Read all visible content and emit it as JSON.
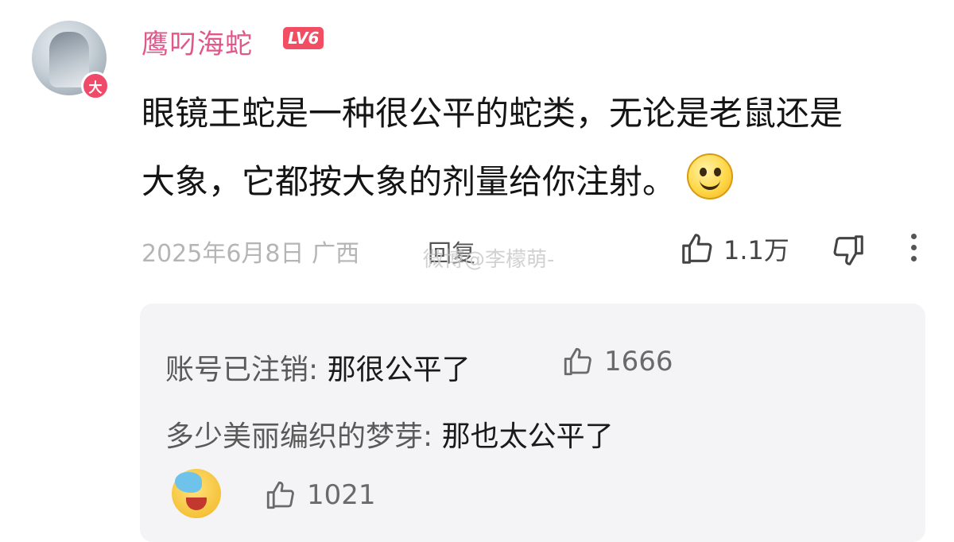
{
  "user": {
    "name": "鹰叼海蛇",
    "level": "LV6",
    "avatar_badge": "大"
  },
  "comment": {
    "line1": "眼镜王蛇是一种很公平的蛇类，无论是老鼠还是",
    "line2": "大象，它都按大象的剂量给你注射。",
    "emoji": "smile-emoji"
  },
  "meta": {
    "date": "2025年6月8日",
    "location": "广西",
    "reply_label": "回复",
    "likes": "1.1万"
  },
  "watermark": "微博@李檬萌-",
  "replies": [
    {
      "name": "账号已注销",
      "text": "那很公平了",
      "likes": "1666"
    },
    {
      "name": "多少美丽编织的梦芽",
      "text": "那也太公平了",
      "likes": "1021",
      "emoji": "cry-laugh-emoji"
    }
  ],
  "colors": {
    "username": "#e0578a",
    "level_bg": "#f24d62",
    "reply_bg": "#f4f4f6"
  }
}
